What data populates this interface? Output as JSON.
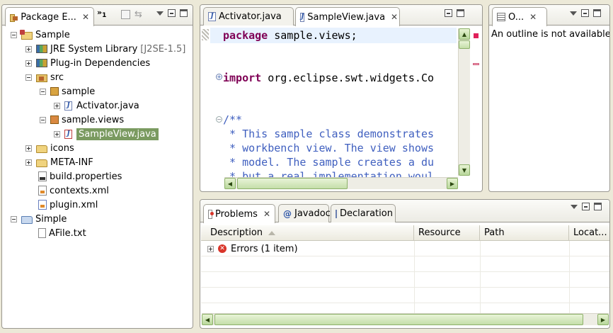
{
  "package_explorer": {
    "tab_label": "Package E...",
    "overflow_count": "1",
    "tree": [
      {
        "label": "Sample",
        "suffix": ""
      },
      {
        "label": "JRE System Library",
        "suffix": "[J2SE-1.5]"
      },
      {
        "label": "Plug-in Dependencies",
        "suffix": ""
      },
      {
        "label": "src",
        "suffix": ""
      },
      {
        "label": "sample",
        "suffix": ""
      },
      {
        "label": "Activator.java",
        "suffix": ""
      },
      {
        "label": "sample.views",
        "suffix": ""
      },
      {
        "label": "SampleView.java",
        "suffix": ""
      },
      {
        "label": "icons",
        "suffix": ""
      },
      {
        "label": "META-INF",
        "suffix": ""
      },
      {
        "label": "build.properties",
        "suffix": ""
      },
      {
        "label": "contexts.xml",
        "suffix": ""
      },
      {
        "label": "plugin.xml",
        "suffix": ""
      },
      {
        "label": "Simple",
        "suffix": ""
      },
      {
        "label": "AFile.txt",
        "suffix": ""
      }
    ]
  },
  "editor": {
    "tabs": [
      {
        "label": "Activator.java"
      },
      {
        "label": "SampleView.java"
      }
    ],
    "lines": [
      {
        "kw": "package",
        "text": " sample.views;"
      },
      {
        "kw": "import",
        "text": " org.eclipse.swt.widgets.Co"
      },
      {
        "text": "/**"
      },
      {
        "text": " * This sample class demonstrates"
      },
      {
        "text": " * workbench view. The view shows"
      },
      {
        "text": " * model. The sample creates a du"
      },
      {
        "text": " * but a real implementation woul"
      }
    ]
  },
  "outline": {
    "tab_label": "O...",
    "message": "An outline is not available."
  },
  "problems": {
    "tabs": [
      {
        "label": "Problems"
      },
      {
        "label": "Javadoc"
      },
      {
        "label": "Declaration"
      }
    ],
    "columns": [
      "Description",
      "Resource",
      "Path",
      "Locat..."
    ],
    "rows": [
      {
        "description": "Errors (1 item)",
        "resource": "",
        "path": "",
        "location": ""
      }
    ]
  },
  "colors": {
    "keyword": "#7f0055",
    "comment": "#3f5fbf",
    "selection": "#7a9a60",
    "error": "#d9352a"
  },
  "icons": [
    "close-icon",
    "view-menu-icon",
    "minimize-icon",
    "maximize-icon",
    "collapse-all-icon",
    "link-editor-icon",
    "java-file-icon",
    "folder-icon",
    "package-icon",
    "error-icon"
  ]
}
